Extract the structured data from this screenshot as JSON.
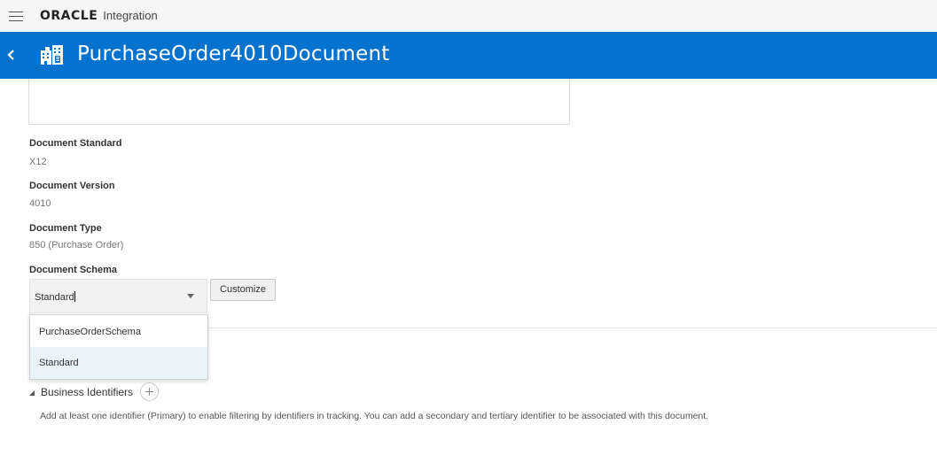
{
  "app": {
    "brand": "ORACLE",
    "product": "Integration"
  },
  "header": {
    "title": "PurchaseOrder4010Document",
    "bg_color": "#0572ce"
  },
  "fields": {
    "standard_label": "Document Standard",
    "standard_value": "X12",
    "version_label": "Document Version",
    "version_value": "4010",
    "type_label": "Document Type",
    "type_value": "850 (Purchase Order)",
    "schema_label": "Document Schema",
    "schema_value": "Standard"
  },
  "customize_label": "Customize",
  "dropdown": {
    "options": [
      "PurchaseOrderSchema",
      "Standard"
    ],
    "highlighted": "Standard"
  },
  "business_identifiers": {
    "label": "Business Identifiers",
    "help": "Add at least one identifier (Primary) to enable filtering by identifiers in tracking. You can add a secondary and tertiary identifier to be associated with this document."
  },
  "icons": {
    "menu": "hamburger-menu-icon",
    "back": "chevron-left-icon",
    "document": "document-buildings-icon",
    "select": "chevron-down-icon",
    "toggle": "triangle-expanded-icon",
    "add": "plus-circle-icon"
  }
}
